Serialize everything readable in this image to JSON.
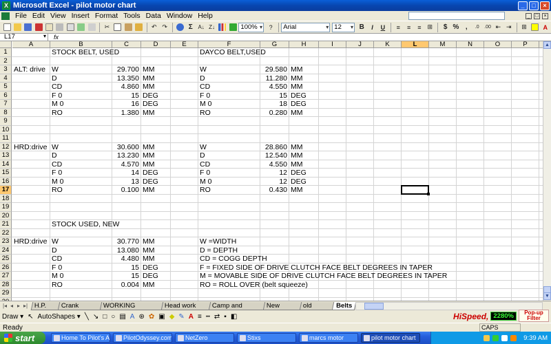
{
  "window": {
    "title": "Microsoft Excel - pilot motor chart"
  },
  "menu": [
    "File",
    "Edit",
    "View",
    "Insert",
    "Format",
    "Tools",
    "Data",
    "Window",
    "Help"
  ],
  "toolbar": {
    "zoom": "100%",
    "font": "Arial",
    "size": "12",
    "bold": "B",
    "italic": "I",
    "underline": "U",
    "sum": "Σ",
    "fx": "fx"
  },
  "namebox": "L17",
  "columns": [
    "A",
    "B",
    "C",
    "D",
    "E",
    "F",
    "G",
    "H",
    "I",
    "J",
    "K",
    "L",
    "M",
    "N",
    "O",
    "P",
    "Q",
    "R"
  ],
  "selected_column": "L",
  "selected_row": "17",
  "rows": [
    "1",
    "2",
    "3",
    "4",
    "5",
    "6",
    "7",
    "8",
    "9",
    "10",
    "11",
    "12",
    "13",
    "14",
    "15",
    "16",
    "17",
    "18",
    "19",
    "20",
    "21",
    "22",
    "23",
    "24",
    "25",
    "26",
    "27",
    "28",
    "29",
    "30"
  ],
  "cells": {
    "B1": "STOCK BELT, USED",
    "F1": "DAYCO BELT,USED",
    "A3": "ALT: drive",
    "B3": "W",
    "C3": "29.700",
    "D3": "MM",
    "F3": "W",
    "G3": "29.580",
    "H3": "MM",
    "B4": "D",
    "C4": "13.350",
    "D4": "MM",
    "F4": "D",
    "G4": "11.280",
    "H4": "MM",
    "B5": "CD",
    "C5": "4.860",
    "D5": "MM",
    "F5": "CD",
    "G5": "4.550",
    "H5": "MM",
    "B6": "F 0",
    "C6": "15",
    "D6": "DEG",
    "F6": "F 0",
    "G6": "15",
    "H6": "DEG",
    "B7": "M 0",
    "C7": "16",
    "D7": "DEG",
    "F7": "M 0",
    "G7": "18",
    "H7": "DEG",
    "B8": "RO",
    "C8": "1.380",
    "D8": "MM",
    "F8": "RO",
    "G8": "0.280",
    "H8": "MM",
    "A12": "HRD:drive",
    "B12": "W",
    "C12": "30.600",
    "D12": "MM",
    "F12": "W",
    "G12": "28.860",
    "H12": "MM",
    "B13": "D",
    "C13": "13.230",
    "D13": "MM",
    "F13": "D",
    "G13": "12.540",
    "H13": "MM",
    "B14": "CD",
    "C14": "4.570",
    "D14": "MM",
    "F14": "CD",
    "G14": "4.550",
    "H14": "MM",
    "B15": "F 0",
    "C15": "14",
    "D15": "DEG",
    "F15": "F 0",
    "G15": "12",
    "H15": "DEG",
    "B16": "M 0",
    "C16": "13",
    "D16": "DEG",
    "F16": "M 0",
    "G16": "12",
    "H16": "DEG",
    "B17": "RO",
    "C17": "0.100",
    "D17": "MM",
    "F17": "RO",
    "G17": "0.430",
    "H17": "MM",
    "B21": "STOCK USED, NEW",
    "A23": "HRD:drive",
    "B23": "W",
    "C23": "30.770",
    "D23": "MM",
    "F23": "W =WIDTH",
    "B24": "D",
    "C24": "13.080",
    "D24": "MM",
    "F24": "D = DEPTH",
    "B25": "CD",
    "C25": "4.480",
    "D25": "MM",
    "F25": "CD = COGG DEPTH",
    "B26": "F 0",
    "C26": "15",
    "D26": "DEG",
    "F26": "F = FIXED SIDE OF DRIVE CLUTCH FACE BELT DEGREES IN TAPER",
    "B27": "M 0",
    "C27": "15",
    "D27": "DEG",
    "F27": "M = MOVABLE SIDE OF DRIVE CLUTCH FACE BELT DEGREES IN TAPER",
    "B28": "RO",
    "C28": "0.004",
    "D28": "MM",
    "F28": "RO = ROLL OVER (belt squeeze)"
  },
  "sheet_tabs": [
    "H.P. #'s",
    "Crank speed",
    "WORKING CHART",
    "Head work CR",
    "Camp and Barrel",
    "New Motor",
    "old motor",
    "Belts"
  ],
  "active_sheet": "Belts",
  "drawbar": {
    "draw": "Draw ▾",
    "autoshapes": "AutoShapes ▾"
  },
  "hispeed": {
    "logo": "HiSpeed,",
    "counter": "2280%",
    "popup": "Pop-up Filter"
  },
  "status": {
    "ready": "Ready",
    "caps": "CAPS"
  },
  "taskbar": {
    "start": "start",
    "tasks": [
      "Home To Pilot's And...",
      "PilotOdyssey.com :...",
      "NetZero",
      "Stixs",
      "marcs motor",
      "pilot motor chart"
    ],
    "active_task": "pilot motor chart",
    "clock": "9:39 AM"
  }
}
